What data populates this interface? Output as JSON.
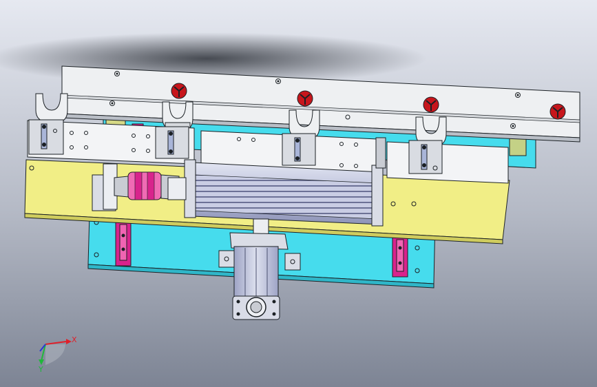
{
  "viewport": {
    "background_top": "#e4e7ef",
    "background_bottom": "#7e8594"
  },
  "triad": {
    "x_label": "X",
    "y_label": "Y",
    "x_color": "#e0202a",
    "y_color": "#1fb83a",
    "z_color": "#2b38d6"
  },
  "colors": {
    "cyan_plate": "#46dced",
    "yellow_plate": "#f1ee86",
    "rail": "#eef0f2",
    "metal": "#c7ccd6",
    "magenta": "#d8238c",
    "pink_coupling": "#f06bb4",
    "red_knob": "#c7161c",
    "cylinder": "#bfc4dd"
  }
}
